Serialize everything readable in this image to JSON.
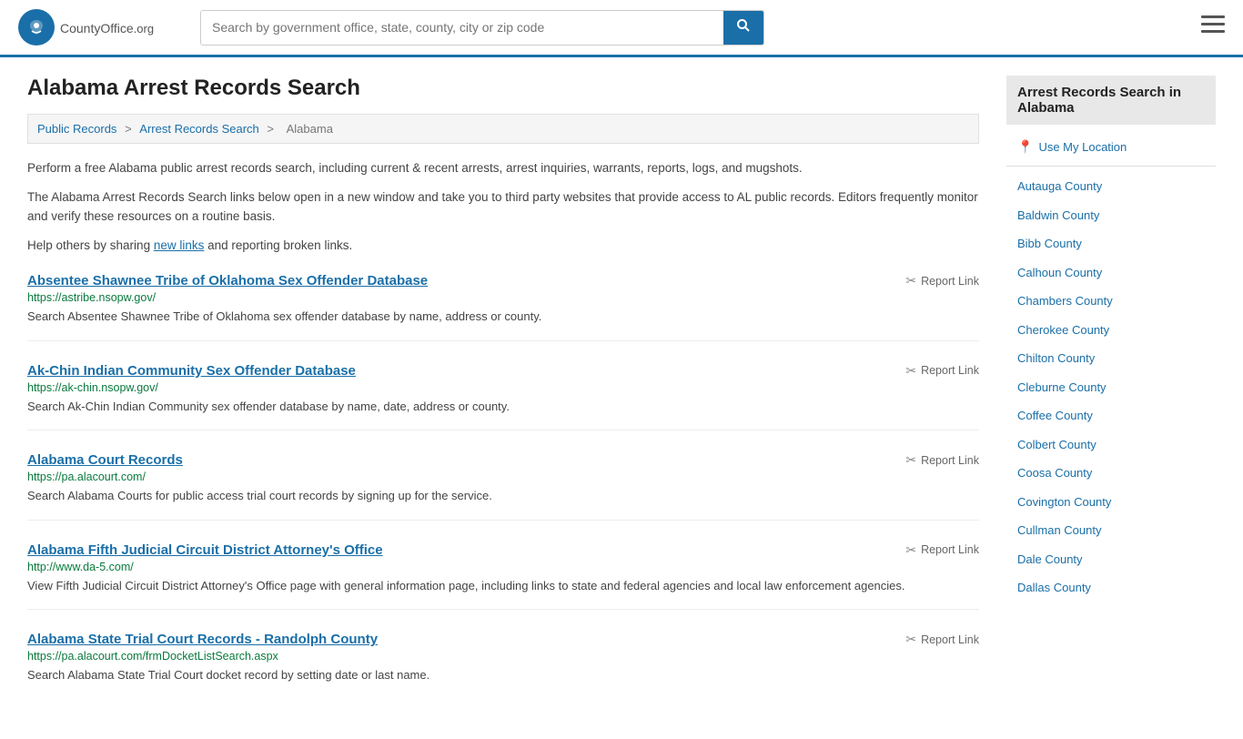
{
  "header": {
    "logo_text": "CountyOffice",
    "logo_suffix": ".org",
    "search_placeholder": "Search by government office, state, county, city or zip code",
    "search_value": ""
  },
  "breadcrumb": {
    "items": [
      "Public Records",
      "Arrest Records Search",
      "Alabama"
    ]
  },
  "page_title": "Alabama Arrest Records Search",
  "descriptions": [
    "Perform a free Alabama public arrest records search, including current & recent arrests, arrest inquiries, warrants, reports, logs, and mugshots.",
    "The Alabama Arrest Records Search links below open in a new window and take you to third party websites that provide access to AL public records. Editors frequently monitor and verify these resources on a routine basis.",
    "Help others by sharing new links and reporting broken links."
  ],
  "results": [
    {
      "title": "Absentee Shawnee Tribe of Oklahoma Sex Offender Database",
      "url": "https://astribe.nsopw.gov/",
      "description": "Search Absentee Shawnee Tribe of Oklahoma sex offender database by name, address or county.",
      "report_label": "Report Link"
    },
    {
      "title": "Ak-Chin Indian Community Sex Offender Database",
      "url": "https://ak-chin.nsopw.gov/",
      "description": "Search Ak-Chin Indian Community sex offender database by name, date, address or county.",
      "report_label": "Report Link"
    },
    {
      "title": "Alabama Court Records",
      "url": "https://pa.alacourt.com/",
      "description": "Search Alabama Courts for public access trial court records by signing up for the service.",
      "report_label": "Report Link"
    },
    {
      "title": "Alabama Fifth Judicial Circuit District Attorney's Office",
      "url": "http://www.da-5.com/",
      "description": "View Fifth Judicial Circuit District Attorney's Office page with general information page, including links to state and federal agencies and local law enforcement agencies.",
      "report_label": "Report Link"
    },
    {
      "title": "Alabama State Trial Court Records - Randolph County",
      "url": "https://pa.alacourt.com/frmDocketListSearch.aspx",
      "description": "Search Alabama State Trial Court docket record by setting date or last name.",
      "report_label": "Report Link"
    }
  ],
  "sidebar": {
    "title": "Arrest Records Search in Alabama",
    "use_my_location": "Use My Location",
    "counties": [
      "Autauga County",
      "Baldwin County",
      "Bibb County",
      "Calhoun County",
      "Chambers County",
      "Cherokee County",
      "Chilton County",
      "Cleburne County",
      "Coffee County",
      "Colbert County",
      "Coosa County",
      "Covington County",
      "Cullman County",
      "Dale County",
      "Dallas County"
    ]
  }
}
